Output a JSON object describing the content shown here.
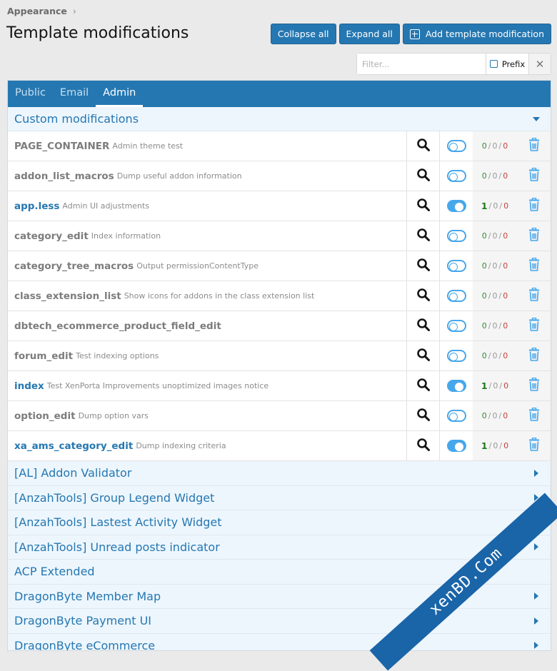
{
  "breadcrumb": {
    "label": "Appearance",
    "chevron": "›"
  },
  "page": {
    "title": "Template modifications"
  },
  "buttons": {
    "collapse_all": "Collapse all",
    "expand_all": "Expand all",
    "add": "Add template modification"
  },
  "filter": {
    "placeholder": "Filter...",
    "prefix_label": "Prefix",
    "clear_glyph": "✕"
  },
  "tabs": [
    "Public",
    "Email",
    "Admin"
  ],
  "active_tab": "Admin",
  "section": {
    "title": "Custom modifications"
  },
  "rows": [
    {
      "name": "PAGE_CONTAINER",
      "desc": "Admin theme test",
      "enabled": false,
      "counts": [
        "0",
        "0",
        "0"
      ]
    },
    {
      "name": "addon_list_macros",
      "desc": "Dump useful addon information",
      "enabled": false,
      "counts": [
        "0",
        "0",
        "0"
      ]
    },
    {
      "name": "app.less",
      "desc": "Admin UI adjustments",
      "enabled": true,
      "counts": [
        "1",
        "0",
        "0"
      ]
    },
    {
      "name": "category_edit",
      "desc": "Index information",
      "enabled": false,
      "counts": [
        "0",
        "0",
        "0"
      ]
    },
    {
      "name": "category_tree_macros",
      "desc": "Output permissionContentType",
      "enabled": false,
      "counts": [
        "0",
        "0",
        "0"
      ]
    },
    {
      "name": "class_extension_list",
      "desc": "Show icons for addons in the class extension list",
      "enabled": false,
      "counts": [
        "0",
        "0",
        "0"
      ]
    },
    {
      "name": "dbtech_ecommerce_product_field_edit",
      "desc": "",
      "enabled": false,
      "counts": [
        "0",
        "0",
        "0"
      ]
    },
    {
      "name": "forum_edit",
      "desc": "Test indexing options",
      "enabled": false,
      "counts": [
        "0",
        "0",
        "0"
      ]
    },
    {
      "name": "index",
      "desc": "Test XenPorta Improvements unoptimized images notice",
      "enabled": true,
      "counts": [
        "1",
        "0",
        "0"
      ]
    },
    {
      "name": "option_edit",
      "desc": "Dump option vars",
      "enabled": false,
      "counts": [
        "0",
        "0",
        "0"
      ]
    },
    {
      "name": "xa_ams_category_edit",
      "desc": "Dump indexing criteria",
      "enabled": true,
      "counts": [
        "1",
        "0",
        "0"
      ]
    }
  ],
  "groups": [
    {
      "name": "[AL] Addon Validator",
      "caret": true
    },
    {
      "name": "[AnzahTools] Group Legend Widget",
      "caret": true
    },
    {
      "name": "[AnzahTools] Lastest Activity Widget",
      "caret": true
    },
    {
      "name": "[AnzahTools] Unread posts indicator",
      "caret": true
    },
    {
      "name": "ACP Extended",
      "caret": false
    },
    {
      "name": "DragonByte Member Map",
      "caret": true
    },
    {
      "name": "DragonByte Payment UI",
      "caret": true
    },
    {
      "name": "DragonByte eCommerce",
      "caret": true
    }
  ],
  "watermark": "xenBD.Com",
  "colors": {
    "accent": "#2577b1",
    "toggle": "#47a7eb",
    "header_bg": "#edf6fd"
  },
  "icons": {
    "search": "search-icon",
    "trash": "trash-icon",
    "toggle": "toggle-switch"
  }
}
